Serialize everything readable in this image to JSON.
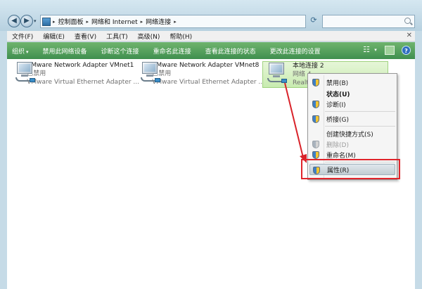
{
  "address": {
    "crumbs": [
      "控制面板",
      "网络和 Internet",
      "网络连接"
    ],
    "search_placeholder": ""
  },
  "menubar": {
    "items": [
      "文件(F)",
      "编辑(E)",
      "查看(V)",
      "工具(T)",
      "高级(N)",
      "帮助(H)"
    ]
  },
  "cmdbar": {
    "organize": "组织",
    "items": [
      "禁用此网络设备",
      "诊断这个连接",
      "重命名此连接",
      "查看此连接的状态",
      "更改此连接的设置"
    ]
  },
  "adapters": [
    {
      "name": "VMware Network Adapter VMnet1",
      "status": "已禁用",
      "desc": "VMware Virtual Ethernet Adapter ..."
    },
    {
      "name": "VMware Network Adapter VMnet8",
      "status": "已禁用",
      "desc": "VMware Virtual Ethernet Adapter ..."
    },
    {
      "name": "本地连接 2",
      "status": "网络 4",
      "desc": "Realte"
    }
  ],
  "context_menu": {
    "items": [
      {
        "label": "禁用(B)"
      },
      {
        "label": "状态(U)"
      },
      {
        "label": "诊断(I)"
      },
      {
        "label": "桥接(G)"
      },
      {
        "label": "创建快捷方式(S)"
      },
      {
        "label": "删除(D)"
      },
      {
        "label": "重命名(M)"
      },
      {
        "label": "属性(R)"
      }
    ]
  },
  "colors": {
    "cmdbar": "#4f9e57",
    "highlight": "#e0242b",
    "selection": "#c8ebb0"
  }
}
